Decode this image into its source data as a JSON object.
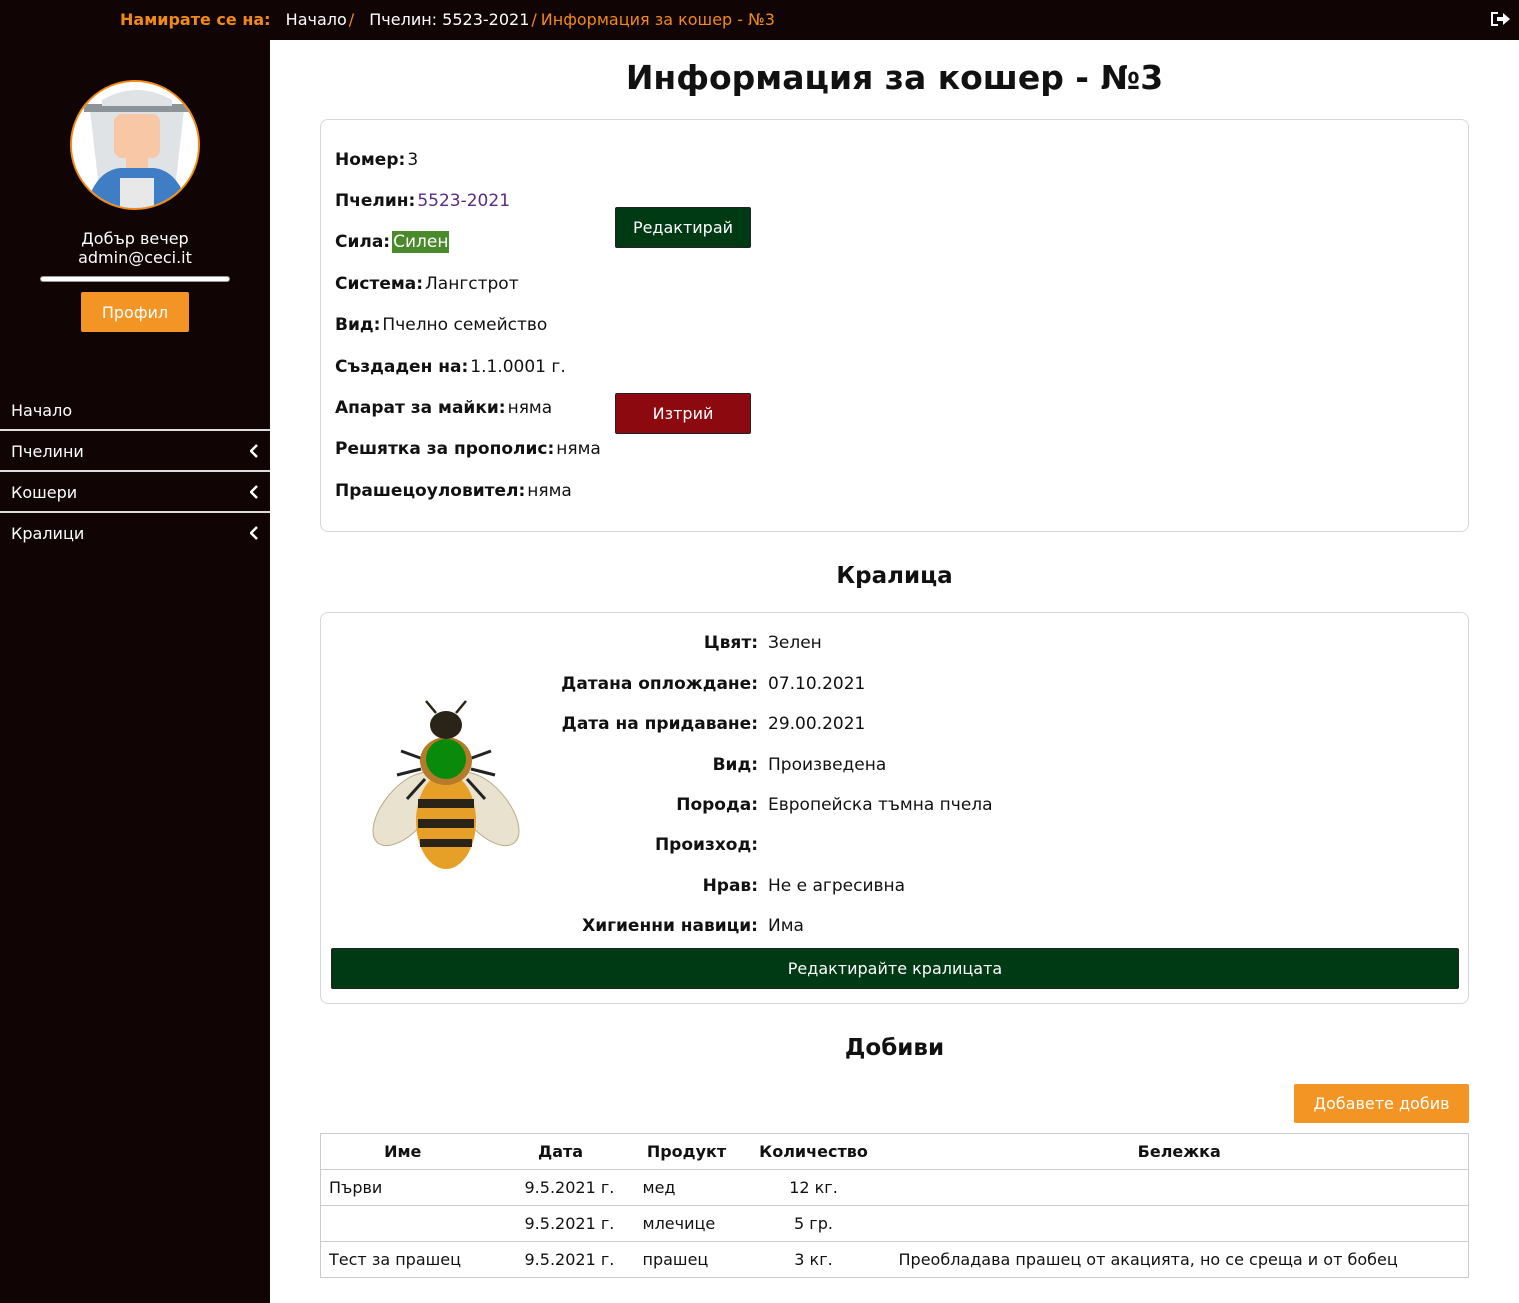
{
  "breadcrumb": {
    "lead": "Намирате се на:",
    "items": [
      "Начало",
      "Пчелин: 5523-2021",
      "Информация за кошер - №3"
    ]
  },
  "sidebar": {
    "greeting": "Добър вечер",
    "user": "admin@ceci.it",
    "profile_label": "Профил",
    "nav": [
      {
        "label": "Начало"
      },
      {
        "label": "Пчелини"
      },
      {
        "label": "Кошери"
      },
      {
        "label": "Кралици"
      }
    ]
  },
  "page": {
    "title": "Информация за кошер - №3"
  },
  "hive": {
    "number_label": "Номер:",
    "number": "3",
    "apiary_label": "Пчелин:",
    "apiary": "5523-2021",
    "strength_label": "Сила:",
    "strength": "Силен",
    "system_label": "Система:",
    "system": "Лангстрот",
    "type_label": "Вид:",
    "type": "Пчелно семейство",
    "created_label": "Създаден на:",
    "created": "1.1.0001 г.",
    "queen_device_label": "Апарат за майки:",
    "queen_device": "няма",
    "propolis_label": "Решятка за прополис:",
    "propolis": "няма",
    "pollen_label": "Прашецоуловител:",
    "pollen": "няма",
    "edit_label": "Редактирай",
    "delete_label": "Изтрий"
  },
  "queen": {
    "section_title": "Кралица",
    "rows": [
      {
        "label": "Цвят:",
        "value": "Зелен"
      },
      {
        "label": "Датана оплождане:",
        "value": "07.10.2021"
      },
      {
        "label": "Дата на придаване:",
        "value": "29.00.2021"
      },
      {
        "label": "Вид:",
        "value": "Произведена"
      },
      {
        "label": "Порода:",
        "value": "Европейска тъмна пчела"
      },
      {
        "label": "Произход:",
        "value": ""
      },
      {
        "label": "Нрав:",
        "value": "Не е агресивна"
      },
      {
        "label": "Хигиенни навици:",
        "value": "Има"
      }
    ],
    "mark_color": "#0a8a0a",
    "edit_label": "Редактирайте кралицата"
  },
  "yields": {
    "section_title": "Добиви",
    "add_label": "Добавете добив",
    "headers": [
      "Име",
      "Дата",
      "Продукт",
      "Количество",
      "Бележка"
    ],
    "rows": [
      [
        "Първи",
        "9.5.2021 г.",
        "мед",
        "12 кг.",
        ""
      ],
      [
        "",
        "9.5.2021 г.",
        "млечице",
        "5 гр.",
        ""
      ],
      [
        "Тест за прашец",
        "9.5.2021 г.",
        "прашец",
        "3 кг.",
        "Преобладава прашец от акацията, но се среща и от бобец"
      ]
    ]
  },
  "colors": {
    "accent": "#f28a17",
    "sidebar_bg": "#100404",
    "edit_green": "#003a14",
    "delete_red": "#8c0a0f",
    "strength_green": "#4a8a2a"
  }
}
